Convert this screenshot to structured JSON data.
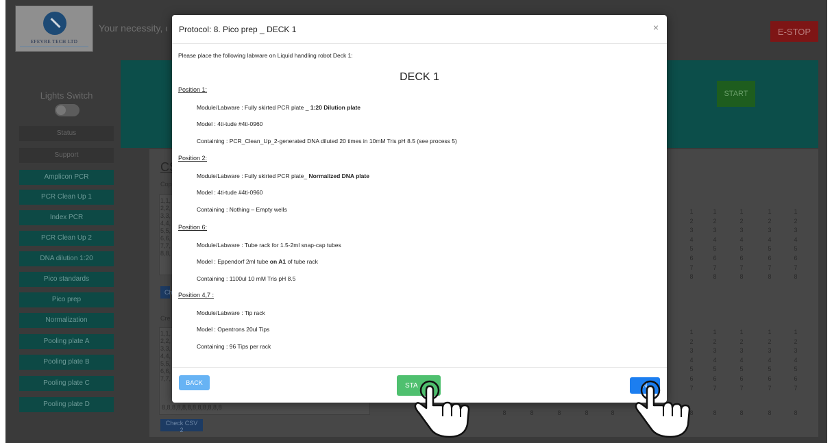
{
  "app": {
    "logo_text": "EFEVRE TECH LTD",
    "tagline": "Your necessity, our",
    "estop_label": "E-STOP",
    "start_top_label": "START",
    "lights_switch_label": "Lights Switch",
    "sidebar": [
      {
        "label": "Status",
        "style": "dark"
      },
      {
        "label": "Support",
        "style": "dark"
      },
      {
        "label": "Amplicon PCR",
        "style": "teal"
      },
      {
        "label": "PCR Clean Up 1",
        "style": "teal"
      },
      {
        "label": "Index PCR",
        "style": "teal"
      },
      {
        "label": "PCR Clean Up 2",
        "style": "teal"
      },
      {
        "label": "DNA dilution 1:20",
        "style": "teal"
      },
      {
        "label": "Pico standards",
        "style": "teal"
      },
      {
        "label": "Pico prep",
        "style": "teal"
      },
      {
        "label": "Normalization",
        "style": "teal"
      },
      {
        "label": "Pooling plate A",
        "style": "teal"
      },
      {
        "label": "Pooling plate B",
        "style": "teal"
      },
      {
        "label": "Pooling plate C",
        "style": "teal"
      },
      {
        "label": "Pooling plate D",
        "style": "teal"
      }
    ],
    "csv": {
      "title": "CS",
      "label1": "Cop",
      "label2": "Cre",
      "lines1": [
        "1,1,",
        "2,2,",
        "3,3,",
        "4,4,",
        "5,5,",
        "6,6,",
        "7,7,",
        "8,8,"
      ],
      "lines2": [
        "1,1,",
        "2,2,",
        "3,3,",
        "4,4,",
        "5,5,",
        "6,6,",
        "7,7,"
      ],
      "last_line": "8,8,8,8,8,8,8,8,8,8,8,8",
      "button1": "Ch",
      "button2": "Check CSV 2",
      "grid_rows": [
        "1",
        "2",
        "3",
        "4",
        "5",
        "6",
        "7",
        "8"
      ]
    }
  },
  "modal": {
    "title": "Protocol: 8. Pico prep _ DECK 1",
    "close_label": "×",
    "intro": "Please place the following labware on Liquid handling robot Deck 1:",
    "heading": "DECK 1",
    "positions": [
      {
        "heading": "Position 1:",
        "module_prefix": "Module/Labware : Fully skirted PCR plate _ ",
        "module_bold": "1:20 Dilution plate",
        "module_suffix": "",
        "model_prefix": "Model : 4ti-tude #4ti-0960",
        "model_bold": "",
        "model_suffix": "",
        "containing": "Containing : PCR_Clean_Up_2-generated DNA diluted 20 times in 10mM Tris pH 8.5 (see process 5)"
      },
      {
        "heading": "Position 2:",
        "module_prefix": "Module/Labware : Fully skirted PCR plate_ ",
        "module_bold": "Normalized DNA plate",
        "module_suffix": "",
        "model_prefix": "Model : 4ti-tude #4ti-0960",
        "model_bold": "",
        "model_suffix": "",
        "containing": "Containing : Nothing – Empty wells"
      },
      {
        "heading": "Position 6:",
        "module_prefix": "Module/Labware : Tube rack for 1.5-2ml snap-cap tubes",
        "module_bold": "",
        "module_suffix": "",
        "model_prefix": "Model : Eppendorf 2ml tube ",
        "model_bold": "on A1",
        "model_suffix": " of tube rack",
        "containing": "Containing : 1100ul 10 mM Tris pH 8.5"
      },
      {
        "heading": "Position 4,7 :",
        "module_prefix": "Module/Labware : Tip rack",
        "module_bold": "",
        "module_suffix": "",
        "model_prefix": "Model : Opentrons 20ul Tips",
        "model_bold": "",
        "model_suffix": "",
        "containing": "Containing : 96 Tips per rack"
      }
    ],
    "back_label": "BACK",
    "start_label": "STA",
    "next_label": "N"
  }
}
